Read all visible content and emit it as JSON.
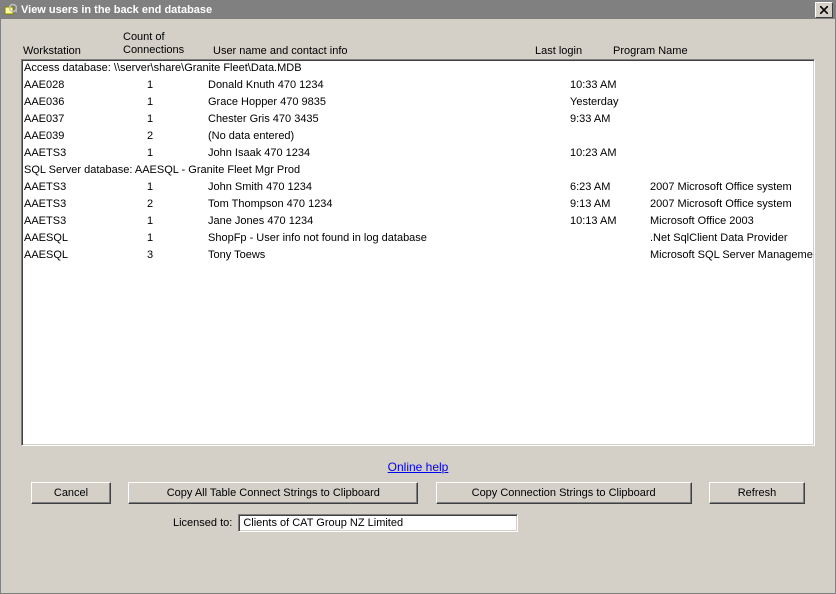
{
  "window": {
    "title": "View users in the back end database"
  },
  "headers": {
    "workstation": "Workstation",
    "count_line1": "Count of",
    "count_line2": "Connections",
    "user": "User name and contact info",
    "last_login": "Last login",
    "program": "Program Name"
  },
  "groups": [
    {
      "label": "Access database: \\\\server\\share\\Granite Fleet\\Data.MDB",
      "rows": [
        {
          "ws": "AAE028",
          "cnt": "1",
          "user": "Donald Knuth 470 1234",
          "last": "10:33 AM",
          "prog": ""
        },
        {
          "ws": "AAE036",
          "cnt": "1",
          "user": "Grace Hopper 470 9835",
          "last": "Yesterday",
          "prog": ""
        },
        {
          "ws": "AAE037",
          "cnt": "1",
          "user": "Chester Gris 470 3435",
          "last": "9:33 AM",
          "prog": ""
        },
        {
          "ws": "AAE039",
          "cnt": "2",
          "user": "  (No data entered)",
          "last": "",
          "prog": ""
        },
        {
          "ws": "AAETS3",
          "cnt": "1",
          "user": "John Isaak 470 1234",
          "last": "10:23 AM",
          "prog": ""
        }
      ]
    },
    {
      "label": "SQL Server database: AAESQL - Granite Fleet Mgr Prod",
      "rows": [
        {
          "ws": "AAETS3",
          "cnt": "1",
          "user": "John Smith 470 1234",
          "last": "6:23 AM",
          "prog": "2007 Microsoft Office system"
        },
        {
          "ws": "AAETS3",
          "cnt": "2",
          "user": "Tom Thompson 470 1234",
          "last": "9:13 AM",
          "prog": "2007 Microsoft Office system"
        },
        {
          "ws": "AAETS3",
          "cnt": "1",
          "user": "Jane Jones 470 1234",
          "last": "10:13 AM",
          "prog": "Microsoft Office 2003"
        },
        {
          "ws": "AAESQL",
          "cnt": "1",
          "user": "ShopFp - User info not found in log database",
          "last": "",
          "prog": ".Net SqlClient Data Provider"
        },
        {
          "ws": "AAESQL",
          "cnt": "3",
          "user": "Tony Toews",
          "last": "",
          "prog": "Microsoft SQL Server Manageme"
        }
      ]
    }
  ],
  "help_link": "Online help",
  "buttons": {
    "cancel": "Cancel",
    "copy_all": "Copy All Table Connect Strings to Clipboard",
    "copy_conn": "Copy Connection Strings to Clipboard",
    "refresh": "Refresh"
  },
  "license": {
    "label": "Licensed to:",
    "value": "Clients of CAT Group NZ Limited"
  }
}
